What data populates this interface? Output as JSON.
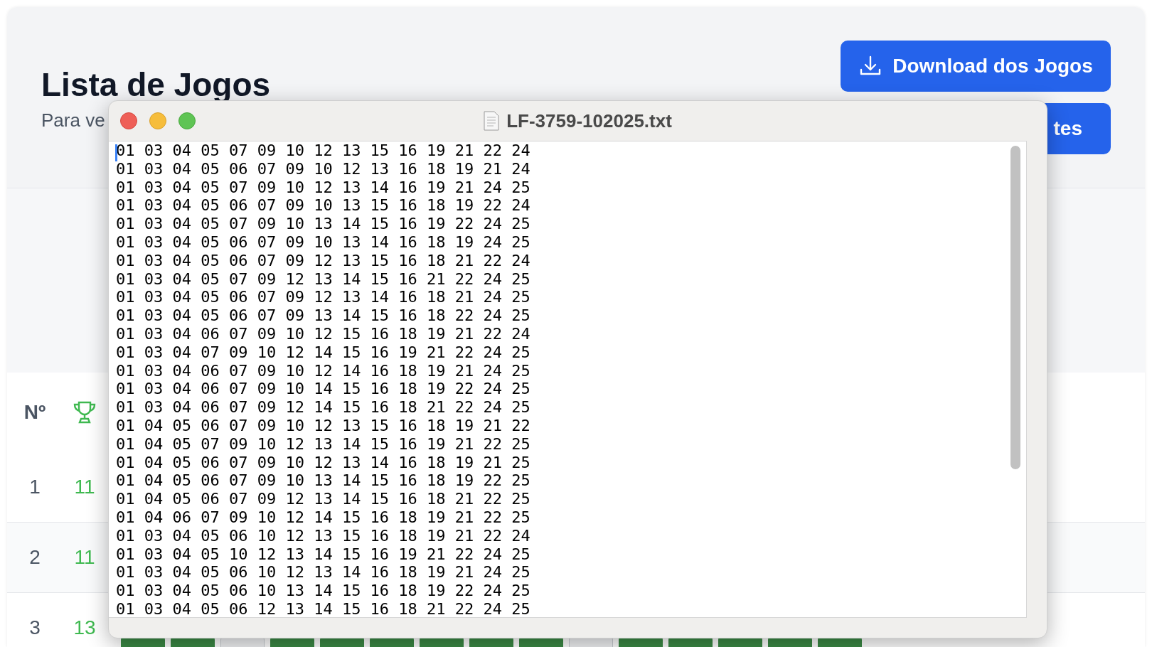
{
  "page": {
    "title": "Lista de Jogos",
    "subtitle": "Para ve",
    "download_button": "Download dos Jogos",
    "second_button": "tes"
  },
  "table": {
    "columns": [
      {
        "kind": "text",
        "label": "Nº"
      },
      {
        "kind": "trophy"
      }
    ],
    "rows": [
      {
        "number": "1",
        "hits": "11"
      },
      {
        "number": "2",
        "hits": "11"
      },
      {
        "number": "3",
        "hits": "13"
      }
    ],
    "pills": [
      {
        "hit": true
      },
      {
        "hit": true
      },
      {
        "hit": false
      },
      {
        "hit": true
      },
      {
        "hit": true
      },
      {
        "hit": true
      },
      {
        "hit": true
      },
      {
        "hit": true
      },
      {
        "hit": true
      },
      {
        "hit": false
      },
      {
        "hit": true
      },
      {
        "hit": true
      },
      {
        "hit": true
      },
      {
        "hit": true
      },
      {
        "hit": true
      }
    ]
  },
  "window": {
    "title": "LF-3759-102025.txt",
    "lines": [
      "01 03 04 05 07 09 10 12 13 15 16 19 21 22 24",
      "01 03 04 05 06 07 09 10 12 13 16 18 19 21 24",
      "01 03 04 05 07 09 10 12 13 14 16 19 21 24 25",
      "01 03 04 05 06 07 09 10 13 15 16 18 19 22 24",
      "01 03 04 05 07 09 10 13 14 15 16 19 22 24 25",
      "01 03 04 05 06 07 09 10 13 14 16 18 19 24 25",
      "01 03 04 05 06 07 09 12 13 15 16 18 21 22 24",
      "01 03 04 05 07 09 12 13 14 15 16 21 22 24 25",
      "01 03 04 05 06 07 09 12 13 14 16 18 21 24 25",
      "01 03 04 05 06 07 09 13 14 15 16 18 22 24 25",
      "01 03 04 06 07 09 10 12 15 16 18 19 21 22 24",
      "01 03 04 07 09 10 12 14 15 16 19 21 22 24 25",
      "01 03 04 06 07 09 10 12 14 16 18 19 21 24 25",
      "01 03 04 06 07 09 10 14 15 16 18 19 22 24 25",
      "01 03 04 06 07 09 12 14 15 16 18 21 22 24 25",
      "01 04 05 06 07 09 10 12 13 15 16 18 19 21 22",
      "01 04 05 07 09 10 12 13 14 15 16 19 21 22 25",
      "01 04 05 06 07 09 10 12 13 14 16 18 19 21 25",
      "01 04 05 06 07 09 10 13 14 15 16 18 19 22 25",
      "01 04 05 06 07 09 12 13 14 15 16 18 21 22 25",
      "01 04 06 07 09 10 12 14 15 16 18 19 21 22 25",
      "01 03 04 05 06 10 12 13 15 16 18 19 21 22 24",
      "01 03 04 05 10 12 13 14 15 16 19 21 22 24 25",
      "01 03 04 05 06 10 12 13 14 16 18 19 21 24 25",
      "01 03 04 05 06 10 13 14 15 16 18 19 22 24 25",
      "01 03 04 05 06 12 13 14 15 16 18 21 22 24 25"
    ]
  }
}
